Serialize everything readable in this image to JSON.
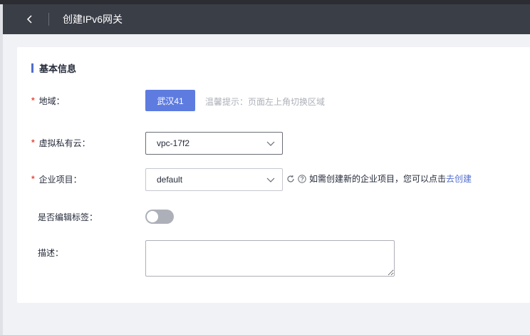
{
  "header": {
    "title": "创建IPv6网关",
    "back_icon": "chevron-left-icon"
  },
  "section": {
    "title": "基本信息"
  },
  "form": {
    "required_mark": "*",
    "region": {
      "label": "地域：",
      "value": "武汉41",
      "hint": "温馨提示：页面左上角切换区域"
    },
    "vpc": {
      "label": "虚拟私有云：",
      "value": "vpc-17f2"
    },
    "enterprise_project": {
      "label": "企业项目：",
      "value": "default",
      "help_text": "如需创建新的企业项目，您可以点击",
      "link_text": "去创建"
    },
    "tags": {
      "label": "是否编辑标签：",
      "enabled": false
    },
    "description": {
      "label": "描述：",
      "value": ""
    }
  },
  "colors": {
    "header_bg": "#3a3e47",
    "primary": "#5e7ce0",
    "link": "#526ecc",
    "required": "#e84a3f",
    "hint": "#adb0b8"
  }
}
